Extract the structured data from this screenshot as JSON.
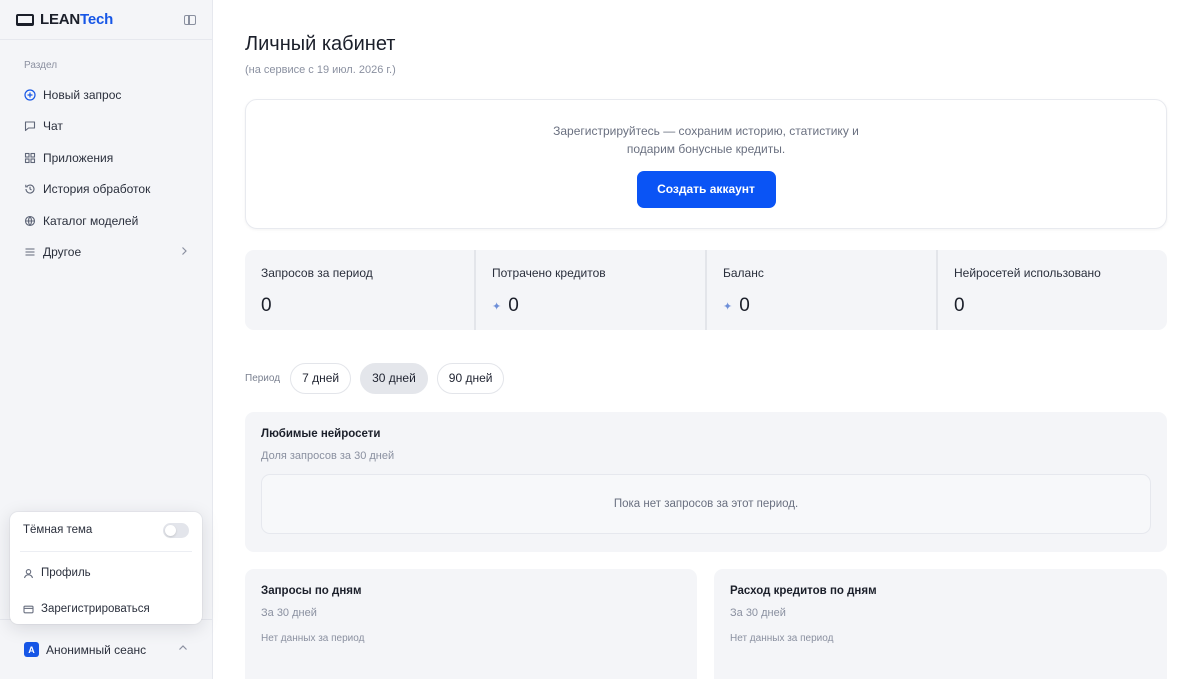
{
  "brand": {
    "name_main": "LEAN",
    "name_accent": "Tech"
  },
  "sidebar": {
    "section_label": "Раздел",
    "items": [
      {
        "label": "Новый запрос",
        "icon": "plus-circle-icon"
      },
      {
        "label": "Чат",
        "icon": "chat-icon"
      },
      {
        "label": "Приложения",
        "icon": "grid-icon"
      },
      {
        "label": "История обработок",
        "icon": "history-icon"
      },
      {
        "label": "Каталог моделей",
        "icon": "globe-icon"
      },
      {
        "label": "Другое",
        "icon": "menu-icon"
      }
    ]
  },
  "popup": {
    "dark_theme": "Тёмная тема",
    "profile": "Профиль",
    "register": "Зарегистрироваться"
  },
  "account": {
    "avatar_letter": "A",
    "label": "Анонимный сеанс"
  },
  "main": {
    "title": "Личный кабинет",
    "subtitle": "(на сервисе с 19 июл. 2026 г.)",
    "register_card": {
      "line1": "Зарегистрируйтесь — сохраним историю, статистику и",
      "line2": "подарим бонусные кредиты.",
      "button": "Создать аккаунт"
    },
    "stats": [
      {
        "label": "Запросов за период",
        "value": "0"
      },
      {
        "label": "Потрачено кредитов",
        "value": "0"
      },
      {
        "label": "Баланс",
        "value": "0"
      },
      {
        "label": "Нейросетей использовано",
        "value": "0"
      }
    ],
    "period": {
      "label": "Период",
      "options": [
        "7 дней",
        "30 дней",
        "90 дней"
      ],
      "selected": "30 дней"
    },
    "favorites": {
      "title": "Любимые нейросети",
      "subtitle": "Доля запросов за 30 дней",
      "empty": "Пока нет запросов за этот период."
    },
    "requests_by_day": {
      "title": "Запросы по дням",
      "subtitle": "За 30 дней",
      "empty": "Нет данных за период"
    },
    "credits_by_day": {
      "title": "Расход кредитов по дням",
      "subtitle": "За 30 дней",
      "empty": "Нет данных за период"
    }
  },
  "colors": {
    "accent": "#0a54f5",
    "sidebar_bg": "#f4f5f8",
    "panel_bg": "#f4f5f8"
  }
}
